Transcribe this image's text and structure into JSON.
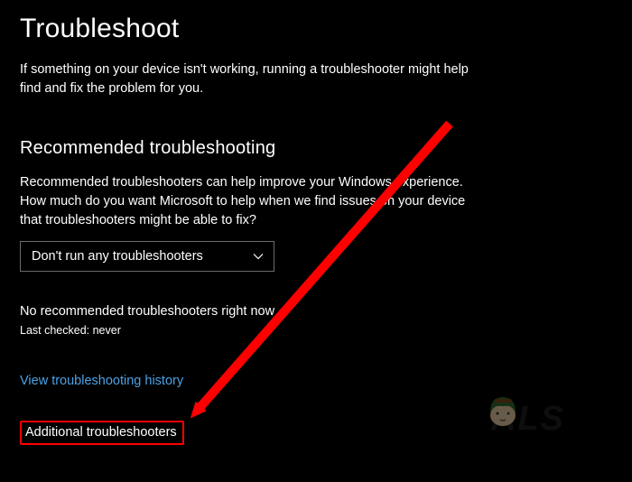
{
  "page": {
    "title": "Troubleshoot",
    "intro": "If something on your device isn't working, running a troubleshooter might help find and fix the problem for you."
  },
  "recommended": {
    "heading": "Recommended troubleshooting",
    "description": "Recommended troubleshooters can help improve your Windows experience. How much do you want Microsoft to help when we find issues on your device that troubleshooters might be able to fix?",
    "dropdown_selected": "Don't run any troubleshooters",
    "status": "No recommended troubleshooters right now",
    "last_checked_label": "Last checked: never"
  },
  "links": {
    "history": "View troubleshooting history",
    "additional": "Additional troubleshooters"
  },
  "watermark": {
    "text": "ALS"
  },
  "annotation": {
    "arrow_color": "#ff0000",
    "highlight_color": "#ff0000"
  }
}
